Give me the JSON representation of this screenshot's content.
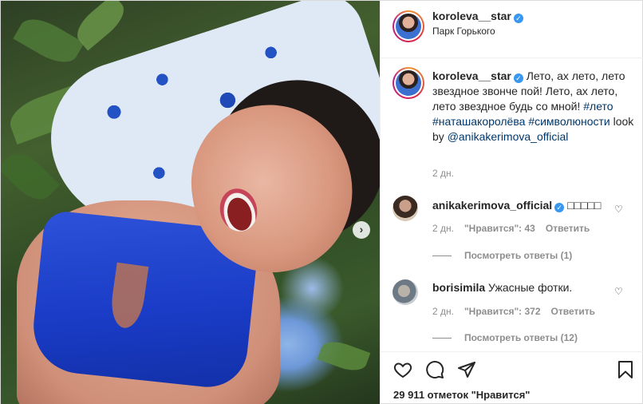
{
  "post": {
    "author": {
      "username": "koroleva__star",
      "verified": true,
      "location": "Парк Горького"
    },
    "media": {
      "next_arrow": "›"
    },
    "caption": {
      "username": "koroleva__star",
      "line1": " Лето, ах лето, лето звездное звонче пой! Лето, ах лето, лето звездное будь со мной! ",
      "tag1": "#лето",
      "tag2": "#наташакоролёва",
      "tag3": "#символюности",
      "mid": " look by ",
      "mention": "@anikakerimova_official",
      "time": "2 дн."
    },
    "comments": [
      {
        "username": "anikakerimova_official",
        "verified": true,
        "text": "□□□□□",
        "time": "2 дн.",
        "likes": "\"Нравится\": 43",
        "reply": "Ответить",
        "view_replies": "Посмотреть ответы (1)"
      },
      {
        "username": "borisimila",
        "verified": false,
        "text": "Ужасные фотки.",
        "time": "2 дн.",
        "likes": "\"Нравится\": 372",
        "reply": "Ответить",
        "view_replies": "Посмотреть ответы (12)"
      }
    ],
    "actions": {
      "icons": [
        "heart-icon",
        "comment-icon",
        "share-icon",
        "bookmark-icon"
      ],
      "likes_text": "29 911 отметок \"Нравится\""
    }
  }
}
